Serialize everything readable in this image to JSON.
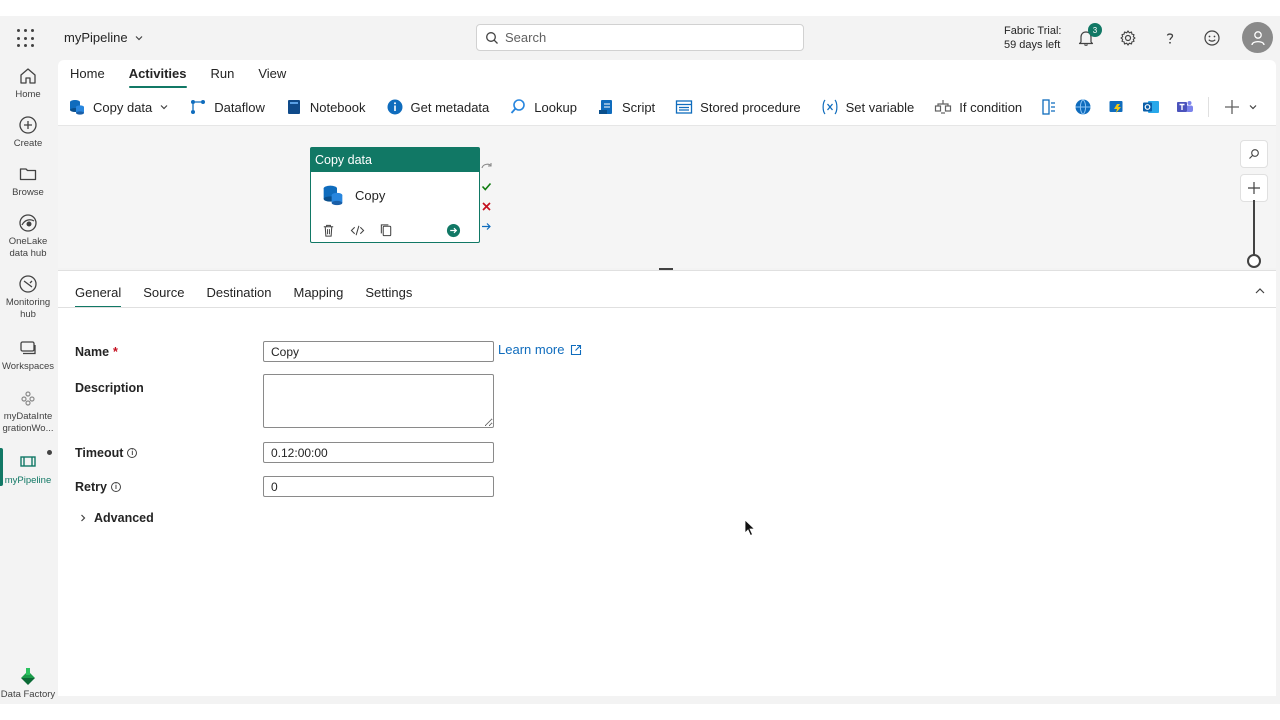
{
  "rail": {
    "items": [
      {
        "label": "Home"
      },
      {
        "label": "Create"
      },
      {
        "label": "Browse"
      },
      {
        "label": "OneLake data hub"
      },
      {
        "label": "Monitoring hub"
      },
      {
        "label": "Workspaces"
      },
      {
        "label": "myDataInte grationWo..."
      },
      {
        "label": "myPipeline"
      }
    ],
    "brand_label": "Data Factory"
  },
  "header": {
    "pipeline_name": "myPipeline",
    "search_placeholder": "Search",
    "trial_line1": "Fabric Trial:",
    "trial_line2": "59 days left",
    "notification_count": "3"
  },
  "ribbon": {
    "tabs": [
      {
        "label": "Home"
      },
      {
        "label": "Activities"
      },
      {
        "label": "Run"
      },
      {
        "label": "View"
      }
    ],
    "tools": [
      {
        "label": "Copy data",
        "icon": "copy-data-icon"
      },
      {
        "label": "Dataflow",
        "icon": "dataflow-icon"
      },
      {
        "label": "Notebook",
        "icon": "notebook-icon"
      },
      {
        "label": "Get metadata",
        "icon": "info-icon"
      },
      {
        "label": "Lookup",
        "icon": "lookup-icon"
      },
      {
        "label": "Script",
        "icon": "script-icon"
      },
      {
        "label": "Stored procedure",
        "icon": "stored-procedure-icon"
      },
      {
        "label": "Set variable",
        "icon": "variable-icon"
      },
      {
        "label": "If condition",
        "icon": "if-condition-icon"
      }
    ]
  },
  "canvas": {
    "node_header": "Copy data",
    "node_name": "Copy"
  },
  "panel": {
    "tabs": [
      {
        "label": "General"
      },
      {
        "label": "Source"
      },
      {
        "label": "Destination"
      },
      {
        "label": "Mapping"
      },
      {
        "label": "Settings"
      }
    ],
    "name_label": "Name",
    "required_mark": "*",
    "name_value": "Copy",
    "learn_more": "Learn more",
    "description_label": "Description",
    "description_value": "",
    "timeout_label": "Timeout",
    "timeout_value": "0.12:00:00",
    "retry_label": "Retry",
    "retry_value": "0",
    "advanced_label": "Advanced"
  },
  "colors": {
    "accent": "#117865",
    "link": "#0f6cbd",
    "required": "#c50f1f"
  }
}
